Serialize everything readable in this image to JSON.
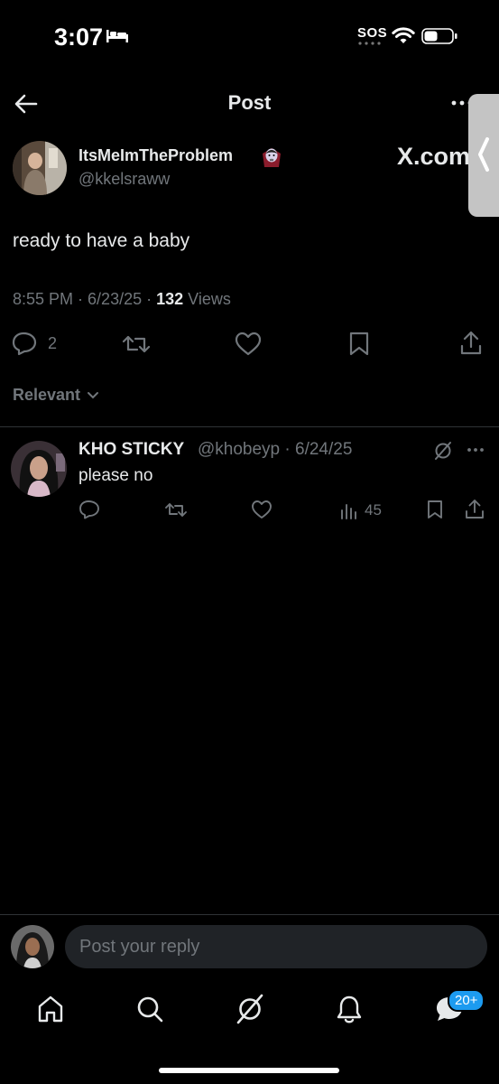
{
  "status_bar": {
    "time": "3:07",
    "sos": "SOS"
  },
  "header": {
    "title": "Post"
  },
  "post": {
    "author_name": "ItsMeImTheProblem",
    "author_emoji": "vampire-emoji",
    "author_handle": "@kkelsraww",
    "overlay_label": "X.com",
    "text": "ready to have a baby",
    "time": "8:55 PM",
    "date": "6/23/25",
    "views_count": "132",
    "views_label": "Views",
    "reply_count": "2"
  },
  "sort": {
    "label": "Relevant"
  },
  "replies": [
    {
      "name": "KHO STICKY",
      "handle": "@khobeyp",
      "date": "6/24/25",
      "text": "please no",
      "views": "45"
    }
  ],
  "composer": {
    "placeholder": "Post your reply"
  },
  "tab_bar": {
    "items": [
      "home-icon",
      "search-icon",
      "grok-icon",
      "notifications-icon",
      "messages-icon"
    ],
    "badge": "20+"
  },
  "colors": {
    "background": "#000000",
    "text_primary": "#e7e9ea",
    "text_secondary": "#71767b",
    "accent": "#1d9bf0",
    "input_bg": "#202327"
  }
}
